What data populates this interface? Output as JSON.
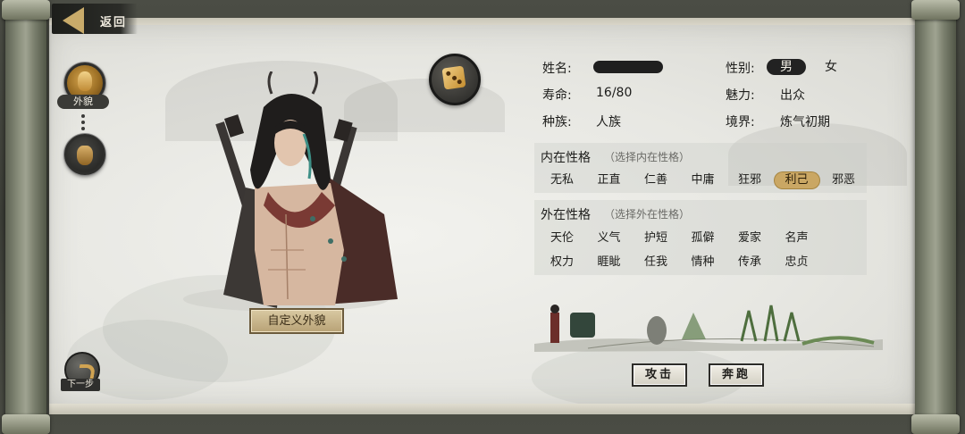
{
  "header": {
    "back_label": "返回"
  },
  "sidebar": {
    "appearance_label": "外貌",
    "next_label": "下一步"
  },
  "portrait": {
    "custom_button": "自定义外貌"
  },
  "info": {
    "name_label": "姓名:",
    "gender_label": "性别:",
    "gender_male": "男",
    "gender_female": "女",
    "gender_selected": "男",
    "lifespan_label": "寿命:",
    "lifespan_value": "16/80",
    "charm_label": "魅力:",
    "charm_value": "出众",
    "race_label": "种族:",
    "race_value": "人族",
    "realm_label": "境界:",
    "realm_value": "炼气初期"
  },
  "inner": {
    "title": "内在性格",
    "hint": "（选择内在性格）",
    "traits": [
      "无私",
      "正直",
      "仁善",
      "中庸",
      "狂邪",
      "利己",
      "邪恶"
    ],
    "selected": "利己"
  },
  "outer": {
    "title": "外在性格",
    "hint": "（选择外在性格）",
    "traits_row1": [
      "天伦",
      "义气",
      "护短",
      "孤僻",
      "爱家",
      "名声"
    ],
    "traits_row2": [
      "权力",
      "睚眦",
      "任我",
      "情种",
      "传承",
      "忠贞"
    ]
  },
  "actions": {
    "attack": "攻击",
    "flee": "奔跑"
  },
  "colors": {
    "selected_trait": "#caa764",
    "gold": "#c9ab6a",
    "ink": "#1d1d1b"
  },
  "icons": [
    "back-arrow-icon",
    "appearance-face-icon",
    "character-token-icon",
    "next-step-arrow-icon",
    "dice-icon"
  ]
}
